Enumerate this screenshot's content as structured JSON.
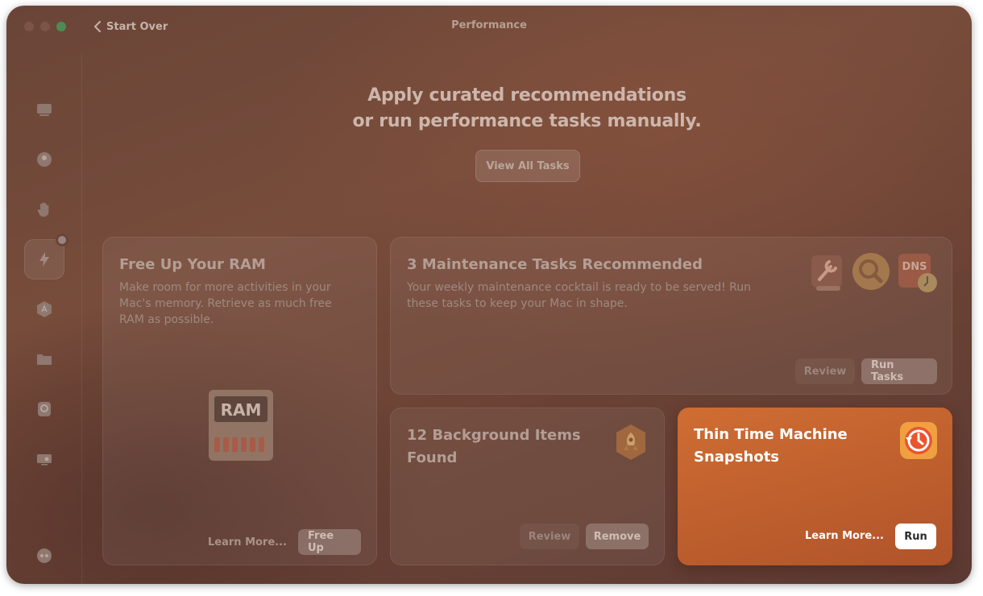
{
  "window": {
    "title": "Performance",
    "back_label": "Start Over"
  },
  "sidebar": {
    "items": [
      {
        "icon": "monitor-icon"
      },
      {
        "icon": "cleanup-icon"
      },
      {
        "icon": "hand-icon"
      },
      {
        "icon": "lightning-icon",
        "active": true
      },
      {
        "icon": "app-icon"
      },
      {
        "icon": "folder-icon"
      },
      {
        "icon": "search-icon"
      },
      {
        "icon": "display-icon"
      },
      {
        "icon": "assistant-icon"
      }
    ]
  },
  "hero": {
    "line1": "Apply curated recommendations",
    "line2": "or run performance tasks manually.",
    "view_all_label": "View All Tasks"
  },
  "ram_card": {
    "title": "Free Up Your RAM",
    "description_lines": [
      "Make room for more activities in your",
      "Mac's memory. Retrieve as much free",
      "RAM as possible."
    ],
    "chip_label": "RAM",
    "learn_more": "Learn More...",
    "action": "Free Up"
  },
  "maintenance_card": {
    "title": "3 Maintenance Tasks Recommended",
    "description_lines": [
      "Your weekly maintenance cocktail is ready to be served! Run",
      "these tasks to keep your Mac in shape."
    ],
    "dns_label": "DNS",
    "review": "Review",
    "action": "Run Tasks"
  },
  "background_card": {
    "title_lines": [
      "12 Background Items",
      "Found"
    ],
    "review": "Review",
    "action": "Remove"
  },
  "timemachine_card": {
    "title_lines": [
      "Thin Time Machine",
      "Snapshots"
    ],
    "learn_more": "Learn More...",
    "action": "Run"
  },
  "colors": {
    "accent_orange": "#c8682f",
    "window_bg": "#6a4537"
  }
}
